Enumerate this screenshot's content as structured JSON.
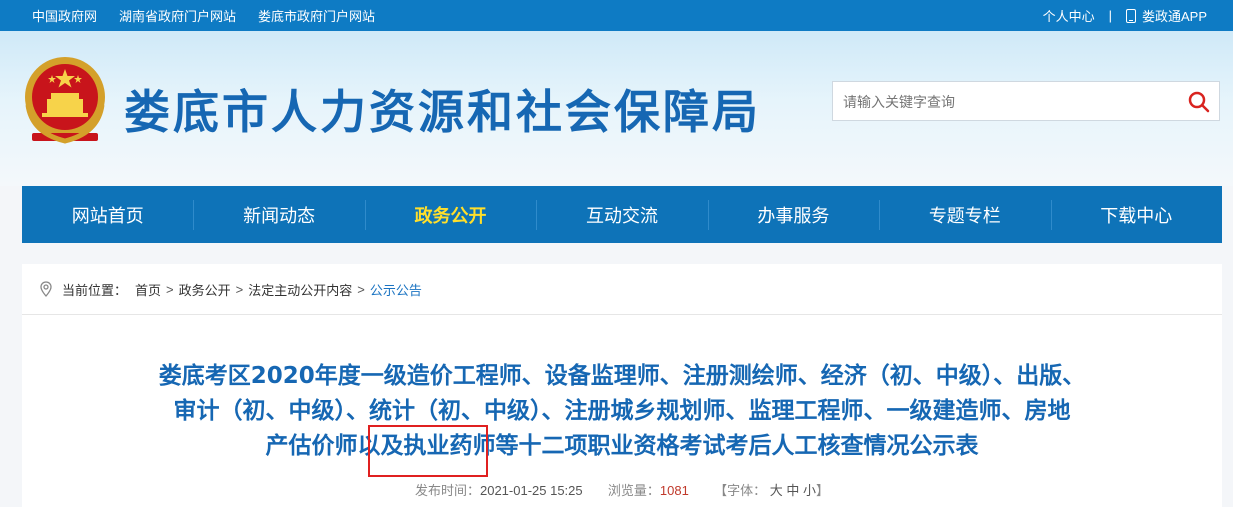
{
  "topbar": {
    "links": [
      "中国政府网",
      "湖南省政府门户网站",
      "娄底市政府门户网站"
    ],
    "user_center": "个人中心",
    "separator": "|",
    "app": "娄政通APP"
  },
  "header": {
    "site_title": "娄底市人力资源和社会保障局",
    "search_placeholder": "请输入关键字查询"
  },
  "nav": {
    "items": [
      "网站首页",
      "新闻动态",
      "政务公开",
      "互动交流",
      "办事服务",
      "专题专栏",
      "下载中心"
    ],
    "active_index": 2
  },
  "breadcrumb": {
    "label": "当前位置：",
    "items": [
      "首页",
      "政务公开",
      "法定主动公开内容",
      "公示公告"
    ],
    "sep": ">"
  },
  "article": {
    "title_lines": [
      "娄底考区2020年度一级造价工程师、设备监理师、注册测绘师、经济（初、中级）、出版、",
      "审计（初、中级）、统计（初、中级）、注册城乡规划师、监理工程师、一级建造师、房地",
      "产估价师以及执业药师等十二项职业资格考试考后人工核查情况公示表"
    ],
    "meta": {
      "published_label": "发布时间：",
      "published": "2021-01-25 15:25",
      "views_label": "浏览量：",
      "views": "1081",
      "font_label": "【字体：",
      "font_large": "大",
      "font_medium": "中",
      "font_small": "小",
      "font_close": "】"
    }
  },
  "colors": {
    "topbar": "#0e7bc4",
    "nav": "#0e73b8",
    "nav_active": "#ffdf2b",
    "title": "#1667b3",
    "highlight": "#e02020"
  }
}
